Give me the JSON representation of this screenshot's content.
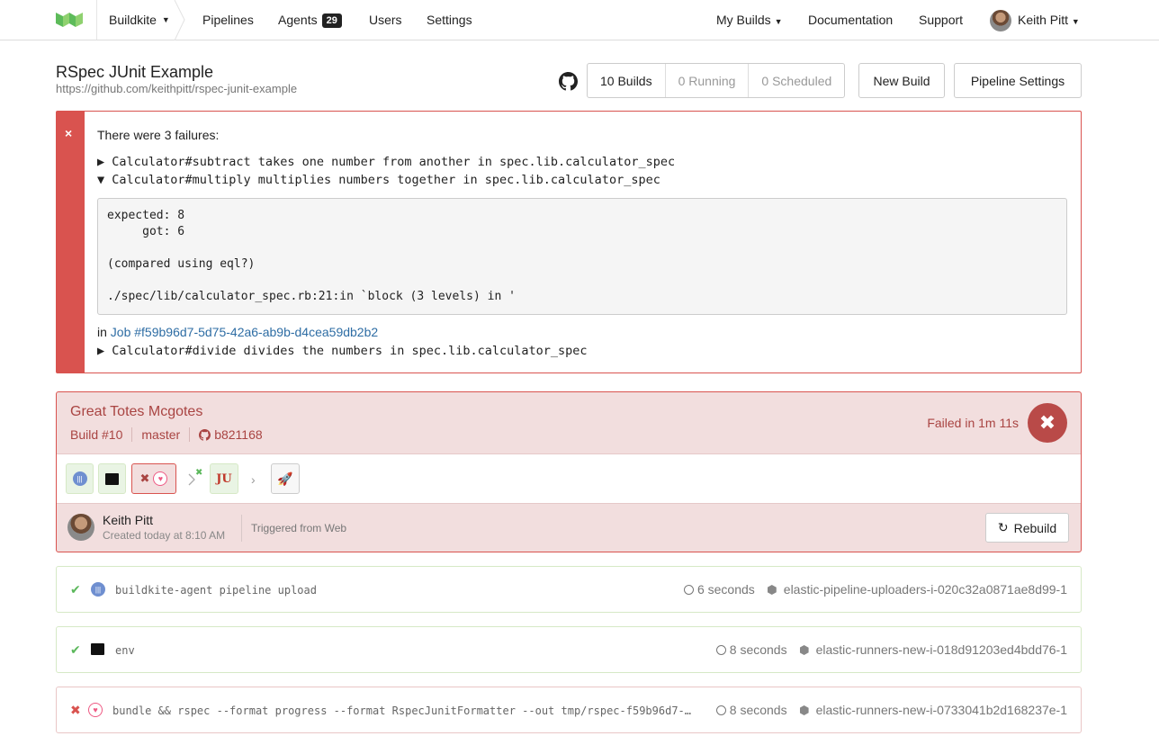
{
  "nav": {
    "org": "Buildkite",
    "links": [
      "Pipelines",
      "Agents",
      "Users",
      "Settings"
    ],
    "agents_count": "29",
    "my_builds": "My Builds",
    "documentation": "Documentation",
    "support": "Support",
    "user": "Keith Pitt"
  },
  "pipeline": {
    "title": "RSpec JUnit Example",
    "repo": "https://github.com/keithpitt/rspec-junit-example",
    "builds": "10 Builds",
    "running": "0 Running",
    "scheduled": "0 Scheduled",
    "new_build": "New Build",
    "settings": "Pipeline Settings"
  },
  "failures": {
    "icon": "×",
    "heading": "There were 3 failures:",
    "items": [
      "▶ Calculator#subtract takes one number from another in spec.lib.calculator_spec",
      "▼ Calculator#multiply multiplies numbers together in spec.lib.calculator_spec",
      "▶ Calculator#divide divides the numbers in spec.lib.calculator_spec"
    ],
    "output": "expected: 8\n     got: 6\n\n(compared using eql?)\n\n./spec/lib/calculator_spec.rb:21:in `block (3 levels) in '",
    "job_prefix": "in ",
    "job_link": "Job #f59b96d7-5d75-42a6-ab9b-d4cea59db2b2"
  },
  "build": {
    "title": "Great Totes Mcgotes",
    "number": "Build #10",
    "branch": "master",
    "commit": "b821168",
    "status_text": "Failed in 1m 11s",
    "author": "Keith Pitt",
    "created": "Created today at 8:10 AM",
    "triggered": "Triggered from Web",
    "rebuild": "Rebuild",
    "steps": [
      {
        "icon": "agent-icon",
        "state": "neutral"
      },
      {
        "icon": "terminal-icon",
        "state": "neutral"
      },
      {
        "icon": "rspec-icon",
        "state": "failed"
      },
      {
        "icon": "junit-icon",
        "state": "passed",
        "label": "JU"
      },
      {
        "icon": "rocket-icon",
        "state": "neutral"
      }
    ]
  },
  "jobs": [
    {
      "status": "passed",
      "command": "buildkite-agent pipeline upload",
      "duration": "6 seconds",
      "agent": "elastic-pipeline-uploaders-i-020c32a0871ae8d99-1"
    },
    {
      "status": "passed",
      "command": "env",
      "duration": "8 seconds",
      "agent": "elastic-runners-new-i-018d91203ed4bdd76-1"
    },
    {
      "status": "failed",
      "command": "bundle && rspec --format progress --format RspecJunitFormatter --out tmp/rspec-f59b96d7-…",
      "duration": "8 seconds",
      "agent": "elastic-runners-new-i-0733041b2d168237e-1"
    }
  ],
  "colors": {
    "failure": "#d9534f",
    "failure_bg": "#f2dede",
    "success": "#5cb85c",
    "link": "#2e6da4"
  }
}
